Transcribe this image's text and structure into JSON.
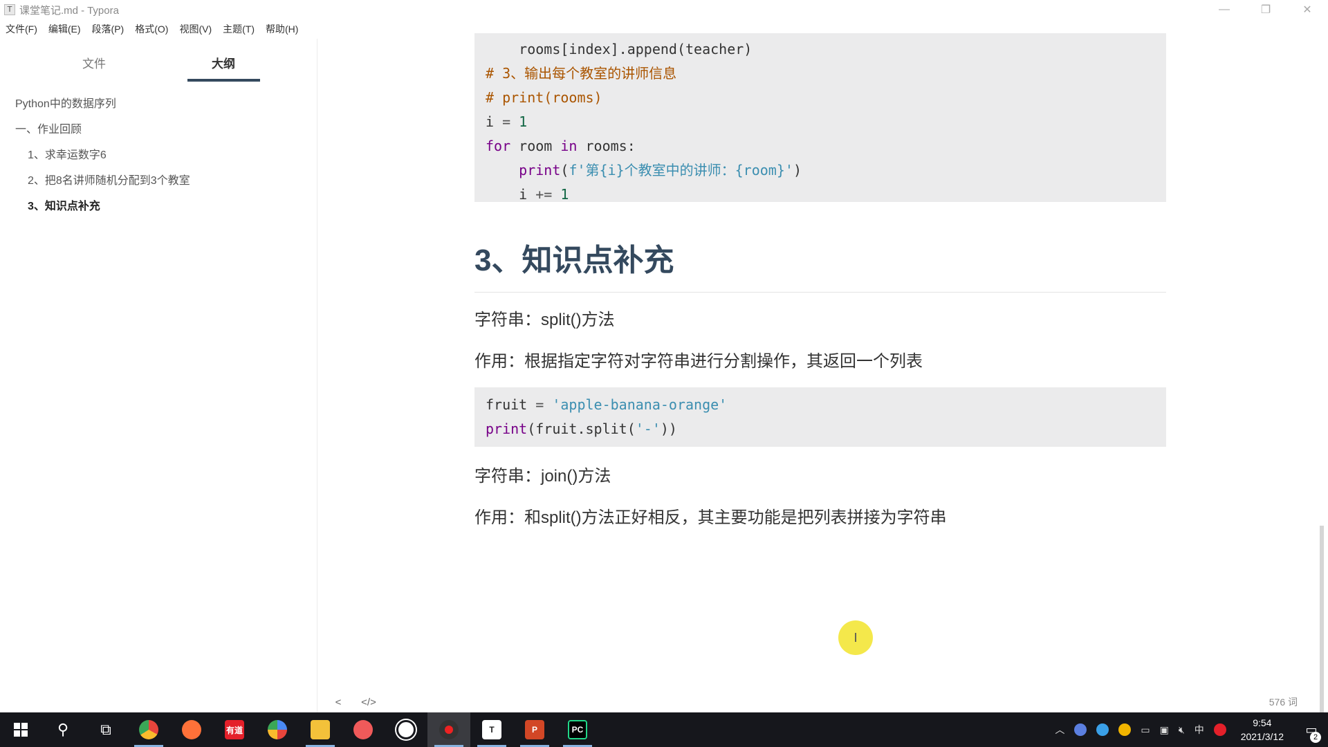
{
  "window": {
    "title": "课堂笔记.md - Typora",
    "app_icon": "T",
    "controls": [
      "minimize",
      "restore",
      "close"
    ]
  },
  "menu": [
    "文件(F)",
    "编辑(E)",
    "段落(P)",
    "格式(O)",
    "视图(V)",
    "主题(T)",
    "帮助(H)"
  ],
  "sidebar": {
    "tabs": [
      "文件",
      "大纲"
    ],
    "active_tab": "大纲",
    "outline": [
      {
        "label": "Python中的数据序列",
        "level": 1,
        "active": false
      },
      {
        "label": "一、作业回顾",
        "level": 1,
        "active": false
      },
      {
        "label": "1、求幸运数字6",
        "level": 2,
        "active": false
      },
      {
        "label": "2、把8名讲师随机分配到3个教室",
        "level": 2,
        "active": false
      },
      {
        "label": "3、知识点补充",
        "level": 2,
        "active": true
      }
    ]
  },
  "editor": {
    "code1": {
      "l1": {
        "indent": "    ",
        "text": "rooms[index].append(teacher)"
      },
      "l2": "# 3、输出每个教室的讲师信息",
      "l3": "# print(rooms)",
      "l4": {
        "a": "i",
        "op": " = ",
        "num": "1"
      },
      "l5": {
        "kw1": "for",
        "a": " room ",
        "kw2": "in",
        "b": " rooms:"
      },
      "l6": {
        "indent": "    ",
        "fn": "print",
        "open": "(",
        "str": "f'第{i}个教室中的讲师：{room}'",
        "close": ")"
      },
      "l7": {
        "indent": "    ",
        "a": "i",
        "op": " += ",
        "num": "1"
      }
    },
    "heading": "3、知识点补充",
    "p1": "字符串：split()方法",
    "p2": "作用：根据指定字符对字符串进行分割操作，其返回一个列表",
    "code2": {
      "l1": {
        "a": "fruit",
        "op": " = ",
        "str": "'apple-banana-orange'"
      },
      "l2": {
        "fn": "print",
        "a": "(fruit.split(",
        "str": "'-'",
        "b": "))"
      }
    },
    "p3": "字符串：join()方法",
    "p4": "作用：和split()方法正好相反，其主要功能是把列表拼接为字符串",
    "cursor_glyph": "I"
  },
  "statusbar": {
    "toggle_sidebar": "<",
    "source_mode": "</>",
    "word_count": "576 词"
  },
  "taskbar": {
    "apps": [
      {
        "name": "chrome",
        "color": "#e8453c",
        "label": ""
      },
      {
        "name": "firefox",
        "color": "#ff7139",
        "label": ""
      },
      {
        "name": "youdao",
        "color": "#e4202a",
        "label": "有道"
      },
      {
        "name": "browser",
        "color": "#4a8af4",
        "label": ""
      },
      {
        "name": "file-explorer",
        "color": "#f3c13a",
        "label": ""
      },
      {
        "name": "recorder",
        "color": "#f05a5a",
        "label": ""
      },
      {
        "name": "steam-like",
        "color": "#ffffff",
        "label": ""
      },
      {
        "name": "screen-recorder",
        "color": "#d11",
        "label": ""
      },
      {
        "name": "typora",
        "color": "#ffffff",
        "label": "T"
      },
      {
        "name": "powerpoint",
        "color": "#d24726",
        "label": "P"
      },
      {
        "name": "pycharm",
        "color": "#21d789",
        "label": "PC"
      }
    ],
    "ime": "中",
    "time": "9:54",
    "date": "2021/3/12",
    "notification_count": "2"
  }
}
